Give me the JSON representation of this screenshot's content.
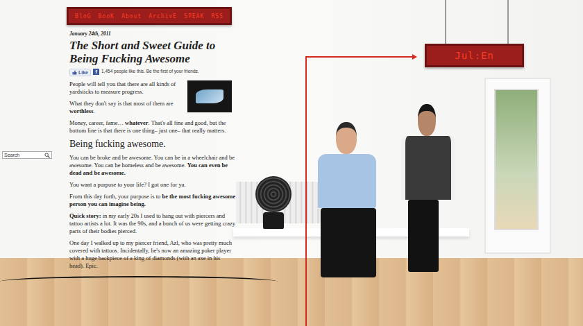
{
  "nav": [
    {
      "label": "BloG"
    },
    {
      "label": "BooK"
    },
    {
      "label": "About"
    },
    {
      "label": "ArchivE"
    },
    {
      "label": "SPEAK"
    },
    {
      "label": "RSS"
    }
  ],
  "sign": {
    "label": "Jul:En"
  },
  "search": {
    "placeholder": "Search"
  },
  "post": {
    "date": "January 24th, 2011",
    "title": "The Short and Sweet Guide to Being Fucking Awesome",
    "like": {
      "button": "Like",
      "badge": "f",
      "count_text": "1,454 people like this. Be the first of your friends."
    },
    "blocks": [
      {
        "kind": "p",
        "segments": [
          {
            "text": "People will tell you that there are all kinds of yardsticks to measure progress.",
            "bold": false
          }
        ]
      },
      {
        "kind": "p",
        "segments": [
          {
            "text": "What they don't say is that most of them are ",
            "bold": false
          },
          {
            "text": "worthless",
            "bold": true
          },
          {
            "text": ".",
            "bold": false
          }
        ]
      },
      {
        "kind": "p",
        "segments": [
          {
            "text": "Money, career, fame… ",
            "bold": false
          },
          {
            "text": "whatever",
            "bold": true
          },
          {
            "text": ". That's all fine and good, but the bottom line is that there is one thing– just one– that really matters.",
            "bold": false
          }
        ]
      },
      {
        "kind": "h2",
        "segments": [
          {
            "text": "Being fucking awesome.",
            "bold": false
          }
        ]
      },
      {
        "kind": "p",
        "segments": [
          {
            "text": "You can be broke and be awesome. You can be in a wheelchair and be awesome. You can be homeless and be awesome. ",
            "bold": false
          },
          {
            "text": "You can even be dead and be awesome.",
            "bold": true
          }
        ]
      },
      {
        "kind": "p",
        "segments": [
          {
            "text": "You want a purpose to your life? I got one for ya.",
            "bold": false
          }
        ]
      },
      {
        "kind": "p",
        "segments": [
          {
            "text": "From this day forth, your purpose is to ",
            "bold": false
          },
          {
            "text": "be the most fucking awesome person you can imagine being.",
            "bold": true
          }
        ]
      },
      {
        "kind": "p",
        "segments": [
          {
            "text": "Quick story:",
            "bold": true
          },
          {
            "text": " in my early 20s I used to hang out with piercers and tattoo artists a lot. It was the 90s, and a bunch of us were getting crazy parts of their bodies pierced.",
            "bold": false
          }
        ]
      },
      {
        "kind": "p",
        "segments": [
          {
            "text": "One day I walked up to my piercer friend, Azl, who was pretty much covered with tattoos. Incidentally, he's now an amazing poker player with a huge backpiece of a king of diamonds (with an axe in his head). Epic.",
            "bold": false
          }
        ]
      }
    ]
  }
}
